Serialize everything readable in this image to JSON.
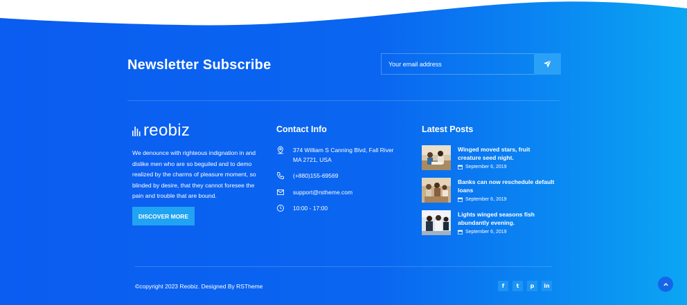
{
  "newsletter": {
    "title": "Newsletter Subscribe",
    "email_placeholder": "Your email address",
    "submit_icon": "paper-plane-icon"
  },
  "brand": {
    "logo_text": "reobiz",
    "logo_icon": "bars-icon",
    "about": "We denounce with righteous indignation in and dislike men who are so beguiled and to demo realized by the charms of pleasure moment, so blinded by desire, that they cannot foresee the pain and trouble that are bound.",
    "cta_label": "DISCOVER MORE"
  },
  "contact": {
    "title": "Contact Info",
    "items": [
      {
        "icon": "map-pin-icon",
        "text": "374 William S Canning Blvd, Fall River MA 2721, USA"
      },
      {
        "icon": "phone-icon",
        "text": "(+880)155-69569"
      },
      {
        "icon": "envelope-icon",
        "text": "support@rstheme.com"
      },
      {
        "icon": "clock-icon",
        "text": "10:00 - 17:00"
      }
    ]
  },
  "posts": {
    "title": "Latest Posts",
    "items": [
      {
        "title": "Winged moved stars, fruit creature seed night.",
        "date": "September 6, 2019"
      },
      {
        "title": "Banks can now reschedule default loans",
        "date": "September 6, 2019"
      },
      {
        "title": "Lights winged seasons fish abundantly evening.",
        "date": "September 6, 2019"
      }
    ]
  },
  "footer": {
    "copyright": "©copyright 2023 Reobiz. Designed By RSTheme",
    "social": [
      {
        "icon": "facebook-icon",
        "glyph": "f"
      },
      {
        "icon": "twitter-icon",
        "glyph": "t"
      },
      {
        "icon": "pinterest-icon",
        "glyph": "p"
      },
      {
        "icon": "linkedin-icon",
        "glyph": "in"
      }
    ],
    "scroll_top_icon": "chevron-up-icon"
  },
  "colors": {
    "gradient_start": "#0b5cf0",
    "gradient_end": "#0ba6f3",
    "accent": "#21a3f3"
  }
}
